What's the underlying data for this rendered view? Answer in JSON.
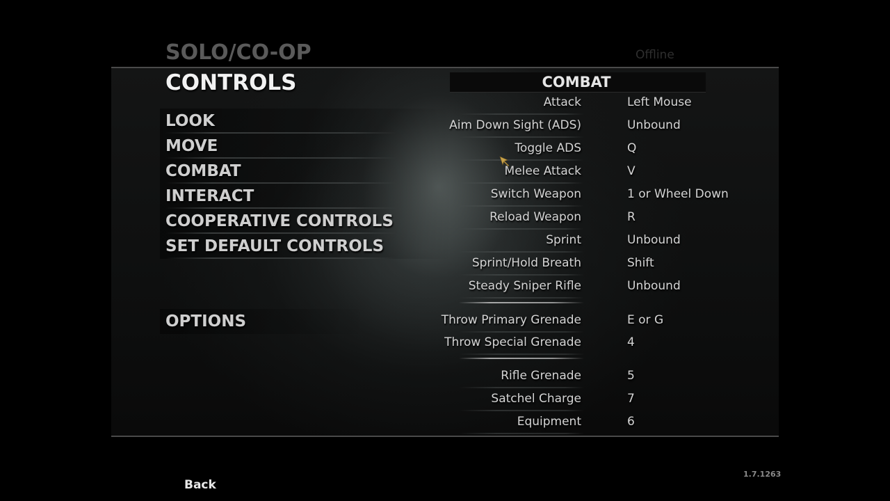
{
  "header": {
    "game_mode": "SOLO/CO-OP",
    "connection_status": "Offline"
  },
  "page": {
    "title": "CONTROLS"
  },
  "menu": {
    "items": [
      {
        "label": "LOOK"
      },
      {
        "label": "MOVE"
      },
      {
        "label": "COMBAT"
      },
      {
        "label": "INTERACT"
      },
      {
        "label": "COOPERATIVE CONTROLS"
      },
      {
        "label": "SET DEFAULT CONTROLS"
      }
    ],
    "options_label": "OPTIONS",
    "selected": "COMBAT"
  },
  "bindings_panel": {
    "section_title": "COMBAT",
    "rows": [
      {
        "action": "Attack",
        "key": "Left Mouse"
      },
      {
        "action": "Aim Down Sight (ADS)",
        "key": "Unbound"
      },
      {
        "action": "Toggle ADS",
        "key": "Q"
      },
      {
        "action": "Melee Attack",
        "key": "V"
      },
      {
        "action": "Switch Weapon",
        "key": "1 or Wheel Down"
      },
      {
        "action": "Reload Weapon",
        "key": "R"
      },
      {
        "action": "Sprint",
        "key": "Unbound"
      },
      {
        "action": "Sprint/Hold Breath",
        "key": "Shift"
      },
      {
        "action": "Steady Sniper Rifle",
        "key": "Unbound"
      },
      {
        "action": "Throw Primary Grenade",
        "key": "E or G"
      },
      {
        "action": "Throw Special Grenade",
        "key": "4"
      },
      {
        "action": "Rifle Grenade",
        "key": "5"
      },
      {
        "action": "Satchel Charge",
        "key": "7"
      },
      {
        "action": "Equipment",
        "key": "6"
      }
    ]
  },
  "footer": {
    "back_label": "Back",
    "version": "1.7.1263"
  },
  "colors": {
    "background": "#000000",
    "title_dim": "#5a5a5a",
    "title_bright": "#f2f2f2",
    "menu_text": "#cfcfcf",
    "binding_text": "#d4d4d4",
    "cursor": "#c8a24a"
  }
}
